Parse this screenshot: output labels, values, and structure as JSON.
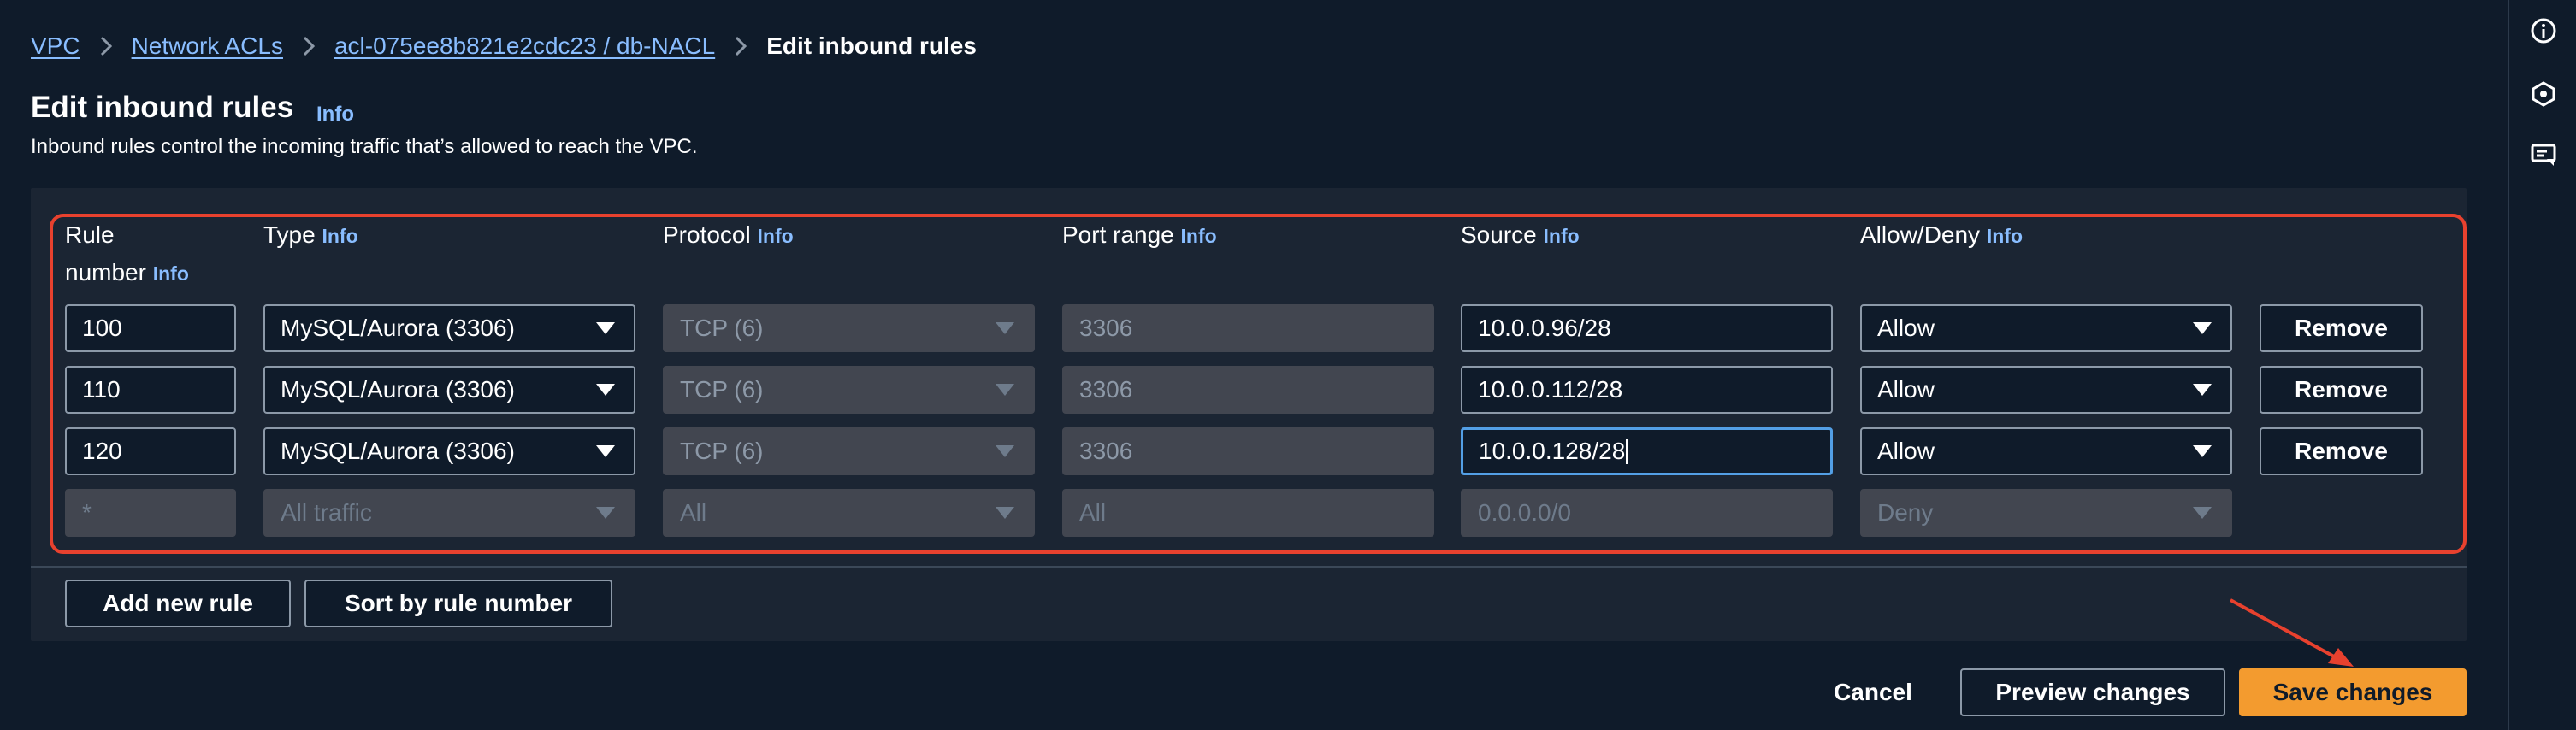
{
  "breadcrumb": {
    "items": [
      "VPC",
      "Network ACLs",
      "acl-075ee8b821e2cdc23 / db-NACL"
    ],
    "current": "Edit inbound rules"
  },
  "header": {
    "title": "Edit inbound rules",
    "info": "Info",
    "description": "Inbound rules control the incoming traffic that’s allowed to reach the VPC."
  },
  "columns": {
    "rule_number_line1": "Rule",
    "rule_number_line2": "number",
    "type": "Type",
    "protocol": "Protocol",
    "port_range": "Port range",
    "source": "Source",
    "allow_deny": "Allow/Deny",
    "info": "Info"
  },
  "rules": [
    {
      "number": "100",
      "type": "MySQL/Aurora (3306)",
      "protocol": "TCP (6)",
      "port_range": "3306",
      "source": "10.0.0.96/28",
      "action": "Allow",
      "remove": "Remove"
    },
    {
      "number": "110",
      "type": "MySQL/Aurora (3306)",
      "protocol": "TCP (6)",
      "port_range": "3306",
      "source": "10.0.0.112/28",
      "action": "Allow",
      "remove": "Remove"
    },
    {
      "number": "120",
      "type": "MySQL/Aurora (3306)",
      "protocol": "TCP (6)",
      "port_range": "3306",
      "source": "10.0.0.128/28",
      "action": "Allow",
      "remove": "Remove"
    }
  ],
  "default_rule": {
    "number": "*",
    "type": "All traffic",
    "protocol": "All",
    "port_range": "All",
    "source": "0.0.0.0/0",
    "action": "Deny"
  },
  "actions": {
    "add_rule": "Add new rule",
    "sort": "Sort by rule number",
    "cancel": "Cancel",
    "preview": "Preview changes",
    "save": "Save changes"
  },
  "icons": {
    "rail": [
      "info-circle-icon",
      "settings-hexagon-icon",
      "feedback-icon"
    ],
    "breadcrumb_separator": "chevron-right-icon",
    "dropdown": "caret-down-icon"
  },
  "colors": {
    "link": "#89bdff",
    "primary": "#f39b2f",
    "highlight": "#e8412e",
    "background": "#0f1b2a"
  }
}
